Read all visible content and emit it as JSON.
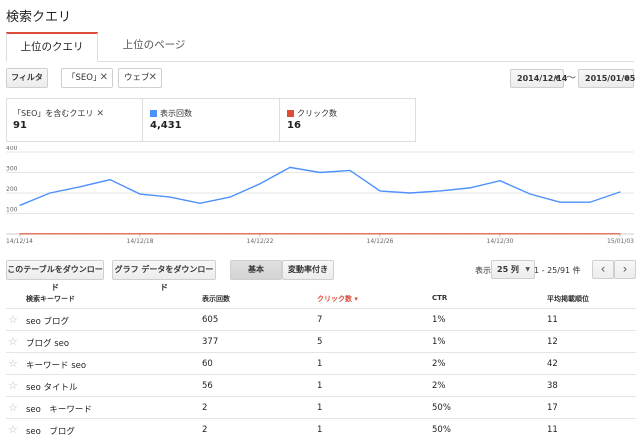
{
  "page": {
    "title": "検索クエリ"
  },
  "tabs": [
    {
      "label": "上位のクエリ",
      "active": true
    },
    {
      "label": "上位のページ",
      "active": false
    }
  ],
  "filters": {
    "filter_button": "フィルタ",
    "chips": [
      {
        "label": "「SEO」"
      },
      {
        "label": "ウェブ"
      }
    ],
    "chip_close_glyph": "✕"
  },
  "date_range": {
    "start": "2014/12/14",
    "end": "2015/01/05",
    "separator": "〜"
  },
  "metrics": [
    {
      "label": "「SEO」を含むクエリ",
      "value": "91",
      "color": "",
      "removable": true
    },
    {
      "label": "表示回数",
      "value": "4,431",
      "color": "#4d90fe",
      "removable": false
    },
    {
      "label": "クリック数",
      "value": "16",
      "color": "#dd4b39",
      "removable": false
    }
  ],
  "chart_data": {
    "type": "line",
    "x": [
      "14/12/14",
      "14/12/15",
      "14/12/16",
      "14/12/17",
      "14/12/18",
      "14/12/19",
      "14/12/20",
      "14/12/21",
      "14/12/22",
      "14/12/23",
      "14/12/24",
      "14/12/25",
      "14/12/26",
      "14/12/27",
      "14/12/28",
      "14/12/29",
      "14/12/30",
      "14/12/31",
      "15/01/01",
      "15/01/02",
      "15/01/03"
    ],
    "x_tick_labels": [
      "14/12/14",
      "14/12/18",
      "14/12/22",
      "14/12/26",
      "14/12/30",
      "15/01/03"
    ],
    "y_tick_labels": [
      "400",
      "300",
      "200",
      "100"
    ],
    "ylim": [
      0,
      400
    ],
    "series": [
      {
        "name": "表示回数",
        "color": "#4d90fe",
        "values": [
          140,
          200,
          230,
          265,
          195,
          180,
          150,
          180,
          245,
          325,
          300,
          310,
          210,
          200,
          210,
          225,
          260,
          195,
          155,
          155,
          205
        ]
      },
      {
        "name": "クリック数",
        "color": "#dd4b39",
        "values": [
          1,
          1,
          1,
          1,
          1,
          1,
          1,
          1,
          1,
          1,
          1,
          1,
          1,
          1,
          1,
          1,
          1,
          1,
          1,
          1,
          1
        ]
      }
    ],
    "grid": true
  },
  "toolbar": {
    "download_table": "このテーブルをダウンロード",
    "download_chart": "グラフ データをダウンロード",
    "view_basic": "基本",
    "view_change": "変動率付き",
    "show_label": "表示",
    "rows_per_page": "25 列",
    "range": "1 - 25/91 件"
  },
  "table": {
    "headers": [
      "検索キーワード",
      "表示回数",
      "クリック数 ▾",
      "CTR",
      "平均掲載順位"
    ],
    "rows": [
      {
        "keyword": "seo ブログ",
        "impressions": "605",
        "clicks": "7",
        "ctr": "1%",
        "position": "11"
      },
      {
        "keyword": "ブログ seo",
        "impressions": "377",
        "clicks": "5",
        "ctr": "1%",
        "position": "12"
      },
      {
        "keyword": "キーワード seo",
        "impressions": "60",
        "clicks": "1",
        "ctr": "2%",
        "position": "42"
      },
      {
        "keyword": "seo タイトル",
        "impressions": "56",
        "clicks": "1",
        "ctr": "2%",
        "position": "38"
      },
      {
        "keyword": "seo　キーワード",
        "impressions": "2",
        "clicks": "1",
        "ctr": "50%",
        "position": "17"
      },
      {
        "keyword": "seo　ブログ",
        "impressions": "2",
        "clicks": "1",
        "ctr": "50%",
        "position": "11"
      }
    ]
  }
}
